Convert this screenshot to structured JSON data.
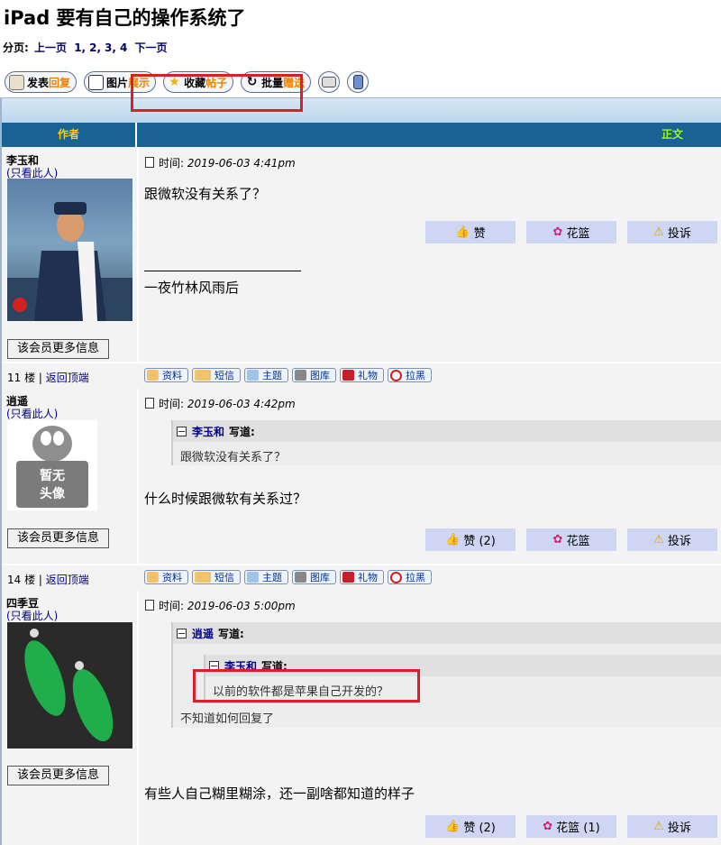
{
  "page": {
    "title": "iPad 要有自己的操作系统了"
  },
  "pager": {
    "label": "分页:",
    "prev": "上一页",
    "pages": [
      "1,",
      "2,",
      "3,",
      "4"
    ],
    "next": "下一页"
  },
  "toolbar": {
    "post": {
      "a": "发表",
      "b": "回复"
    },
    "pics": {
      "a": "图片",
      "b": "展示"
    },
    "fav": {
      "a": "收藏",
      "b": "帖子"
    },
    "batch": {
      "a": "批量",
      "b": "赠送"
    }
  },
  "table": {
    "author_header": "作者",
    "content_header": "正文"
  },
  "posts": [
    {
      "author": "李玉和",
      "only": "(只看此人)",
      "time_label": "时间:",
      "time": "2019-06-03 4:41pm",
      "body": "跟微软没有关系了？",
      "signature": "一夜竹林风雨后",
      "like": "赞",
      "basket": "花篮",
      "report": "投诉",
      "more": "该会员更多信息",
      "floor": "11 楼",
      "top": "返回顶端"
    },
    {
      "author": "逍遥",
      "only": "(只看此人)",
      "time_label": "时间:",
      "time": "2019-06-03 4:42pm",
      "quote_author": "李玉和",
      "quote_word": "写道:",
      "quote_text": "跟微软没有关系了？",
      "body": "什么时候跟微软有关系过？",
      "like": "赞 (2)",
      "basket": "花篮",
      "report": "投诉",
      "more": "该会员更多信息",
      "avatar_text": [
        "暂无",
        "头像"
      ],
      "floor": "14 楼",
      "top": "返回顶端"
    },
    {
      "author": "四季豆",
      "only": "(只看此人)",
      "time_label": "时间:",
      "time": "2019-06-03 5:00pm",
      "quote_author": "逍遥",
      "quote_word": "写道:",
      "inner_quote_author": "李玉和",
      "inner_quote_word": "写道:",
      "inner_quote_text": "以前的软件都是苹果自己开发的？",
      "quote_text": "不知道如何回复了",
      "body": "有些人自己糊里糊涂，还一副啥都知道的样子",
      "like": "赞 (2)",
      "basket": "花篮 (1)",
      "report": "投诉",
      "more": "该会员更多信息"
    }
  ],
  "footer_buttons": [
    "资料",
    "短信",
    "主题",
    "图库",
    "礼物",
    "拉黑"
  ],
  "colors": {
    "header_bg": "#186294",
    "action_bg": "#cfd6f3",
    "highlight": "#d9202a"
  }
}
